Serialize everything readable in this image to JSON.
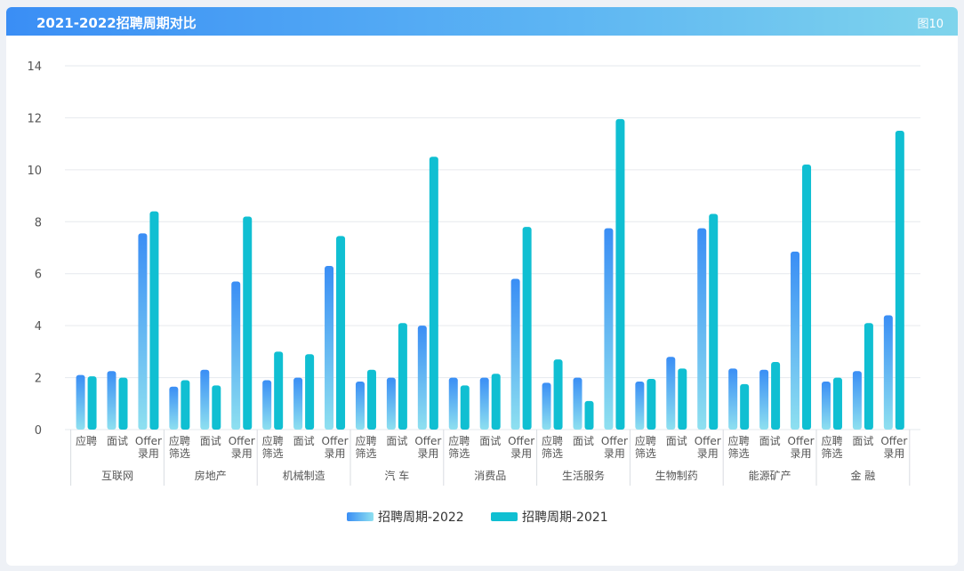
{
  "header": {
    "title": "2021-2022招聘周期对比",
    "figure_label": "图10"
  },
  "colors": {
    "series_2022_top": "#3a8ef5",
    "series_2022_bottom": "#8ee0f0",
    "series_2021": "#10bfd2",
    "grid": "#e6e9ee",
    "axis_text": "#555555"
  },
  "chart_data": {
    "type": "bar",
    "title": "",
    "ylim": [
      0,
      14
    ],
    "yticks": [
      0,
      2,
      4,
      6,
      8,
      10,
      12,
      14
    ],
    "grid": true,
    "legend_position": "bottom-center",
    "groups": [
      {
        "name": "互联网",
        "stages": [
          [
            "应聘"
          ],
          [
            "面试"
          ],
          [
            "Offer",
            "录用"
          ]
        ]
      },
      {
        "name": "房地产",
        "stages": [
          [
            "应聘",
            "筛选"
          ],
          [
            "面试"
          ],
          [
            "Offer",
            "录用"
          ]
        ]
      },
      {
        "name": "机械制造",
        "stages": [
          [
            "应聘",
            "筛选"
          ],
          [
            "面试"
          ],
          [
            "Offer",
            "录用"
          ]
        ]
      },
      {
        "name": "汽 车",
        "stages": [
          [
            "应聘",
            "筛选"
          ],
          [
            "面试"
          ],
          [
            "Offer",
            "录用"
          ]
        ]
      },
      {
        "name": "消费品",
        "stages": [
          [
            "应聘",
            "筛选"
          ],
          [
            "面试"
          ],
          [
            "Offer",
            "录用"
          ]
        ]
      },
      {
        "name": "生活服务",
        "stages": [
          [
            "应聘",
            "筛选"
          ],
          [
            "面试"
          ],
          [
            "Offer",
            "录用"
          ]
        ]
      },
      {
        "name": "生物制药",
        "stages": [
          [
            "应聘",
            "筛选"
          ],
          [
            "面试"
          ],
          [
            "Offer",
            "录用"
          ]
        ]
      },
      {
        "name": "能源矿产",
        "stages": [
          [
            "应聘",
            "筛选"
          ],
          [
            "面试"
          ],
          [
            "Offer",
            "录用"
          ]
        ]
      },
      {
        "name": "金 融",
        "stages": [
          [
            "应聘",
            "筛选"
          ],
          [
            "面试"
          ],
          [
            "Offer",
            "录用"
          ]
        ]
      }
    ],
    "series": [
      {
        "name": "招聘周期-2022",
        "values": [
          2.1,
          2.25,
          7.55,
          1.65,
          2.3,
          5.7,
          1.9,
          2.0,
          6.3,
          1.85,
          2.0,
          4.0,
          2.0,
          2.0,
          5.8,
          1.8,
          2.0,
          7.75,
          1.85,
          2.8,
          7.75,
          2.35,
          2.3,
          6.85,
          1.85,
          2.25,
          4.4
        ]
      },
      {
        "name": "招聘周期-2021",
        "values": [
          2.05,
          2.0,
          8.4,
          1.9,
          1.7,
          8.2,
          3.0,
          2.9,
          7.45,
          2.3,
          4.1,
          10.5,
          1.7,
          2.15,
          7.8,
          2.7,
          1.1,
          11.95,
          1.95,
          2.35,
          8.3,
          1.75,
          2.6,
          10.2,
          2.0,
          4.1,
          11.5
        ]
      }
    ]
  }
}
